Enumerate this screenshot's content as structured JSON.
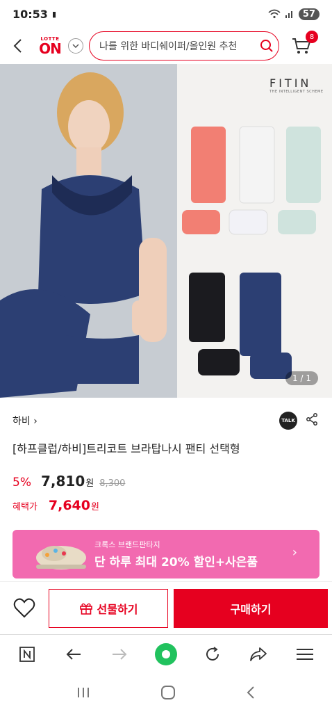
{
  "status": {
    "time": "10:53",
    "battery": "57"
  },
  "header": {
    "logo_top": "LOTTE",
    "logo_main": "ON",
    "search_placeholder": "나를 위한 바디쉐이퍼/올인원 추천",
    "cart_count": "8"
  },
  "hero": {
    "brand_logo": "FITIN",
    "brand_tagline": "THE INTELLIGENT SCHEME",
    "counter": "1 / 1"
  },
  "product": {
    "brand": "하비",
    "brand_chevron": "›",
    "talk_label": "TALK",
    "title": "[하프클럽/하비]트리코트 브라탑나시 팬티 선택형",
    "discount": "5%",
    "price": "7,810",
    "won": "원",
    "original_price": "8,300",
    "benefit_label": "혜택가",
    "benefit_price": "7,640",
    "benefit_won": "원"
  },
  "banner": {
    "subtitle": "크록스 브랜드판타지",
    "title": "단 하루 최대 20% 할인+사은품",
    "chevron": "›"
  },
  "actions": {
    "gift_label": "선물하기",
    "buy_label": "구매하기"
  },
  "colors": {
    "accent": "#e6001f",
    "banner": "#f26ab0",
    "browser_green": "#21c25e"
  }
}
